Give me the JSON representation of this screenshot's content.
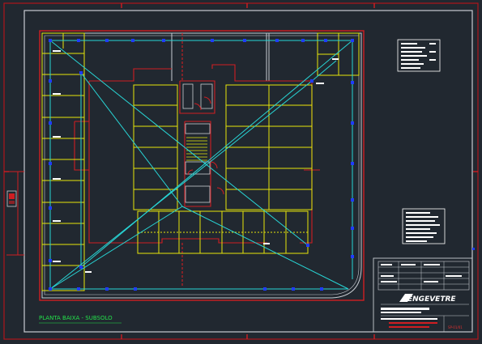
{
  "drawing": {
    "title": "PLANTA BAIXA - SUBSOLO",
    "company_logo": "ENGEVETRE",
    "sheet_code": "SP-01/01"
  },
  "colors": {
    "background": "#212830",
    "sheet_border": "#b0161b",
    "inner_frame": "#c8ccd2",
    "building_wall": "#d01e22",
    "parking_lines": "#e6e60a",
    "wiring": "#28d6d6",
    "devices": "#1f3bff",
    "title_text": "#23e04a"
  }
}
